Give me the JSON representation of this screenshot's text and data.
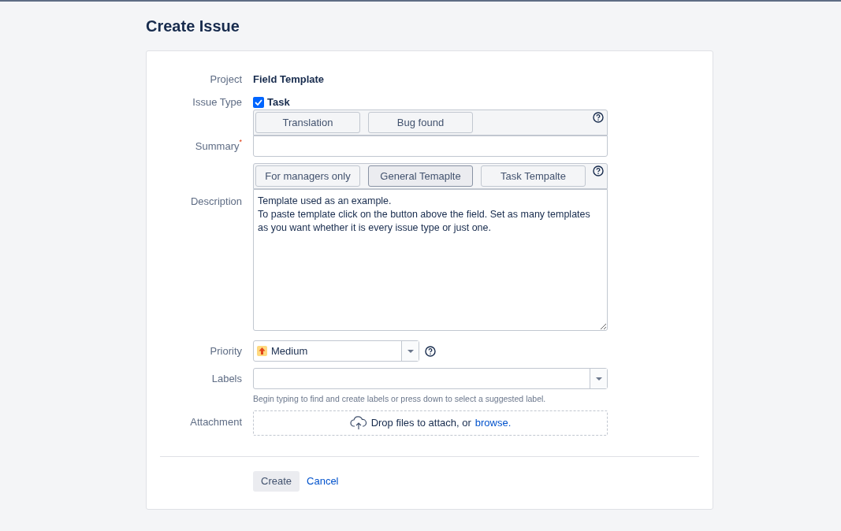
{
  "page_title": "Create Issue",
  "project": {
    "label": "Project",
    "value": "Field Template"
  },
  "issue_type": {
    "label": "Issue Type",
    "value": "Task",
    "checked": true
  },
  "summary": {
    "label": "Summary",
    "required_mark": "*",
    "templates": [
      {
        "label": "Translation",
        "selected": false
      },
      {
        "label": "Bug found",
        "selected": false
      }
    ]
  },
  "description": {
    "label": "Description",
    "templates": [
      {
        "label": "For managers only",
        "selected": false
      },
      {
        "label": "General Temaplte",
        "selected": true
      },
      {
        "label": "Task Tempalte",
        "selected": false
      }
    ],
    "value": "Template used as an example.\nTo paste template click on the button above the field. Set as many templates as you want whether it is every issue type or just one."
  },
  "priority": {
    "label": "Priority",
    "value": "Medium"
  },
  "labels": {
    "label": "Labels",
    "hint": "Begin typing to find and create labels or press down to select a suggested label."
  },
  "attachment": {
    "label": "Attachment",
    "text": "Drop files to attach, or",
    "link": "browse."
  },
  "buttons": {
    "create": "Create",
    "cancel": "Cancel"
  }
}
